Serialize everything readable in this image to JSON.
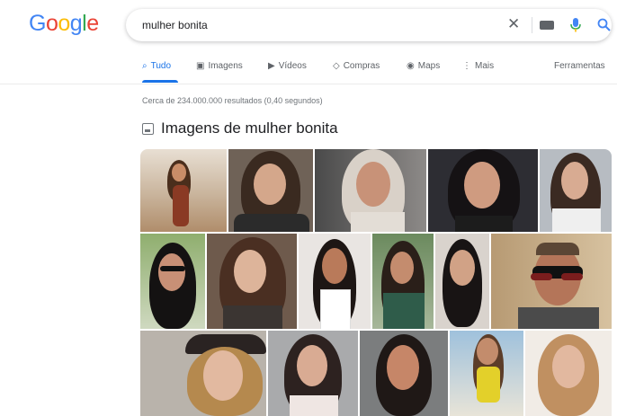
{
  "logo": {
    "letters": [
      "G",
      "o",
      "o",
      "g",
      "l",
      "e"
    ],
    "colors": [
      "#4285f4",
      "#ea4335",
      "#fbbc05",
      "#4285f4",
      "#34a853",
      "#ea4335"
    ]
  },
  "search": {
    "value": "mulher bonita"
  },
  "tabs": [
    {
      "label": "Tudo",
      "icon": "search-icon",
      "active": true
    },
    {
      "label": "Imagens",
      "icon": "image-icon",
      "active": false
    },
    {
      "label": "Vídeos",
      "icon": "video-icon",
      "active": false
    },
    {
      "label": "Compras",
      "icon": "tag-icon",
      "active": false
    },
    {
      "label": "Maps",
      "icon": "pin-icon",
      "active": false
    },
    {
      "label": "Mais",
      "icon": "more-icon",
      "active": false
    }
  ],
  "tools_label": "Ferramentas",
  "results_stats": "Cerca de 234.000.000 resultados (0,40 segundos)",
  "images_section": {
    "title": "Imagens de mulher bonita"
  },
  "colors": {
    "accent": "#1a73e8"
  }
}
